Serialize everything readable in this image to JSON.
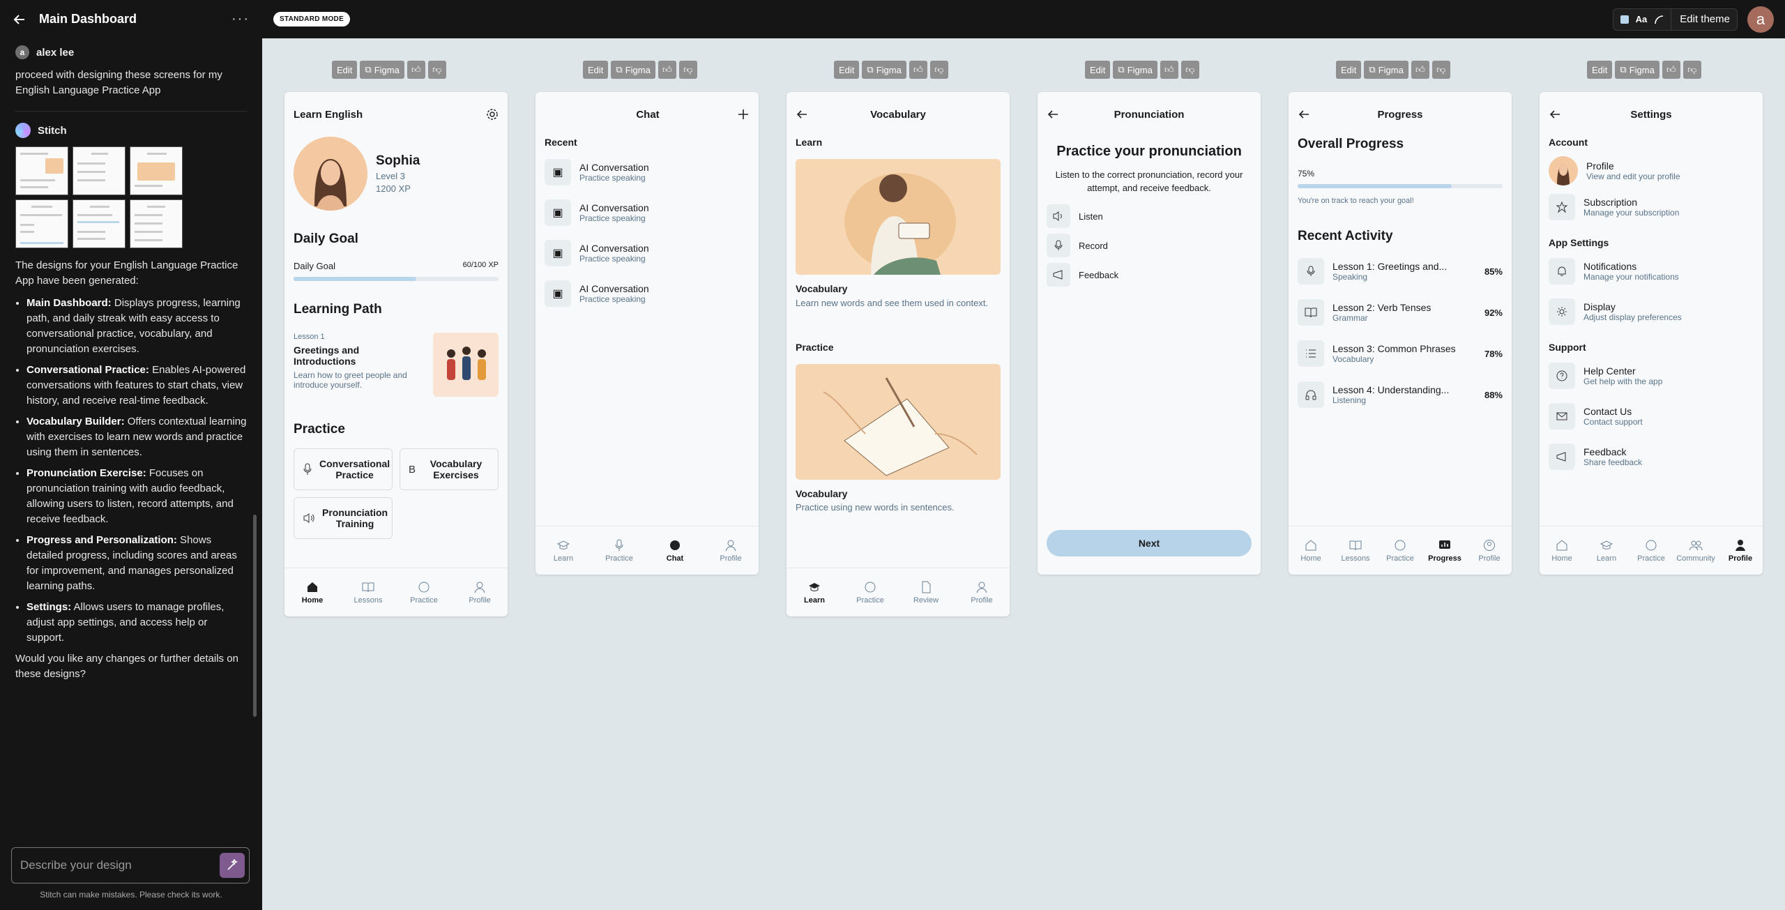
{
  "sidebar": {
    "title": "Main Dashboard",
    "user_name": "alex lee",
    "user_initial": "a",
    "user_message": "proceed with designing these screens for my English Language Practice App",
    "assistant_name": "Stitch",
    "intro": "The designs for your English Language Practice App have been generated:",
    "items": [
      {
        "title": "Main Dashboard:",
        "text": " Displays progress, learning path, and daily streak with easy access to conversational practice, vocabulary, and pronunciation exercises."
      },
      {
        "title": "Conversational Practice:",
        "text": " Enables AI-powered conversations with features to start chats, view history, and receive real-time feedback."
      },
      {
        "title": "Vocabulary Builder:",
        "text": " Offers contextual learning with exercises to learn new words and practice using them in sentences."
      },
      {
        "title": "Pronunciation Exercise:",
        "text": " Focuses on pronunciation training with audio feedback, allowing users to listen, record attempts, and receive feedback."
      },
      {
        "title": "Progress and Personalization:",
        "text": " Shows detailed progress, including scores and areas for improvement, and manages personalized learning paths."
      },
      {
        "title": "Settings:",
        "text": " Allows users to manage profiles, adjust app settings, and access help or support."
      }
    ],
    "closing": "Would you like any changes or further details on these designs?",
    "composer_placeholder": "Describe your design",
    "disclaimer": "Stitch can make mistakes. Please check its work."
  },
  "topbar": {
    "mode": "STANDARD MODE",
    "theme_aa": "Aa",
    "edit_theme": "Edit theme",
    "avatar": "a"
  },
  "toolbar": {
    "edit": "Edit",
    "figma": "Figma"
  },
  "home": {
    "header": "Learn English",
    "name": "Sophia",
    "level": "Level 3",
    "xp": "1200 XP",
    "daily_goal_heading": "Daily Goal",
    "daily_goal_label": "Daily Goal",
    "daily_goal_value": "60/100 XP",
    "daily_goal_fraction": 0.6,
    "learning_path_heading": "Learning Path",
    "lesson_label": "Lesson 1",
    "lesson_title": "Greetings and Introductions",
    "lesson_desc": "Learn how to greet people and introduce yourself.",
    "practice_heading": "Practice",
    "practice_cards": [
      "Conversational Practice",
      "Vocabulary Exercises",
      "Pronunciation Training"
    ],
    "nav": [
      "Home",
      "Lessons",
      "Practice",
      "Profile"
    ]
  },
  "chat": {
    "header": "Chat",
    "recent_heading": "Recent",
    "items": [
      {
        "title": "AI Conversation",
        "sub": "Practice speaking"
      },
      {
        "title": "AI Conversation",
        "sub": "Practice speaking"
      },
      {
        "title": "AI Conversation",
        "sub": "Practice speaking"
      },
      {
        "title": "AI Conversation",
        "sub": "Practice speaking"
      }
    ],
    "nav": [
      "Learn",
      "Practice",
      "Chat",
      "Profile"
    ]
  },
  "vocab": {
    "header": "Vocabulary",
    "learn_heading": "Learn",
    "card1_title": "Vocabulary",
    "card1_desc": "Learn new words and see them used in context.",
    "practice_heading": "Practice",
    "card2_title": "Vocabulary",
    "card2_desc": "Practice using new words in sentences.",
    "nav": [
      "Learn",
      "Practice",
      "Review",
      "Profile"
    ]
  },
  "pron": {
    "header": "Pronunciation",
    "title": "Practice your pronunciation",
    "desc": "Listen to the correct pronunciation, record your attempt, and receive feedback.",
    "items": [
      "Listen",
      "Record",
      "Feedback"
    ],
    "next": "Next"
  },
  "progress": {
    "header": "Progress",
    "overall_heading": "Overall Progress",
    "overall_value": "75%",
    "overall_fraction": 0.75,
    "on_track": "You're on track to reach your goal!",
    "recent_heading": "Recent Activity",
    "items": [
      {
        "title": "Lesson 1: Greetings and...",
        "sub": "Speaking",
        "pct": "85%",
        "icon": "mic-icon"
      },
      {
        "title": "Lesson 2: Verb Tenses",
        "sub": "Grammar",
        "pct": "92%",
        "icon": "book-icon"
      },
      {
        "title": "Lesson 3: Common Phrases",
        "sub": "Vocabulary",
        "pct": "78%",
        "icon": "list-icon"
      },
      {
        "title": "Lesson 4: Understanding...",
        "sub": "Listening",
        "pct": "88%",
        "icon": "headphones-icon"
      }
    ],
    "nav": [
      "Home",
      "Lessons",
      "Practice",
      "Progress",
      "Profile"
    ]
  },
  "settings": {
    "header": "Settings",
    "account_heading": "Account",
    "profile_title": "Profile",
    "profile_sub": "View and edit your profile",
    "subscription_title": "Subscription",
    "subscription_sub": "Manage your subscription",
    "app_heading": "App Settings",
    "notifications_title": "Notifications",
    "notifications_sub": "Manage your notifications",
    "display_title": "Display",
    "display_sub": "Adjust display preferences",
    "support_heading": "Support",
    "help_title": "Help Center",
    "help_sub": "Get help with the app",
    "contact_title": "Contact Us",
    "contact_sub": "Contact support",
    "feedback_title": "Feedback",
    "feedback_sub": "Share feedback",
    "nav": [
      "Home",
      "Learn",
      "Practice",
      "Community",
      "Profile"
    ]
  }
}
